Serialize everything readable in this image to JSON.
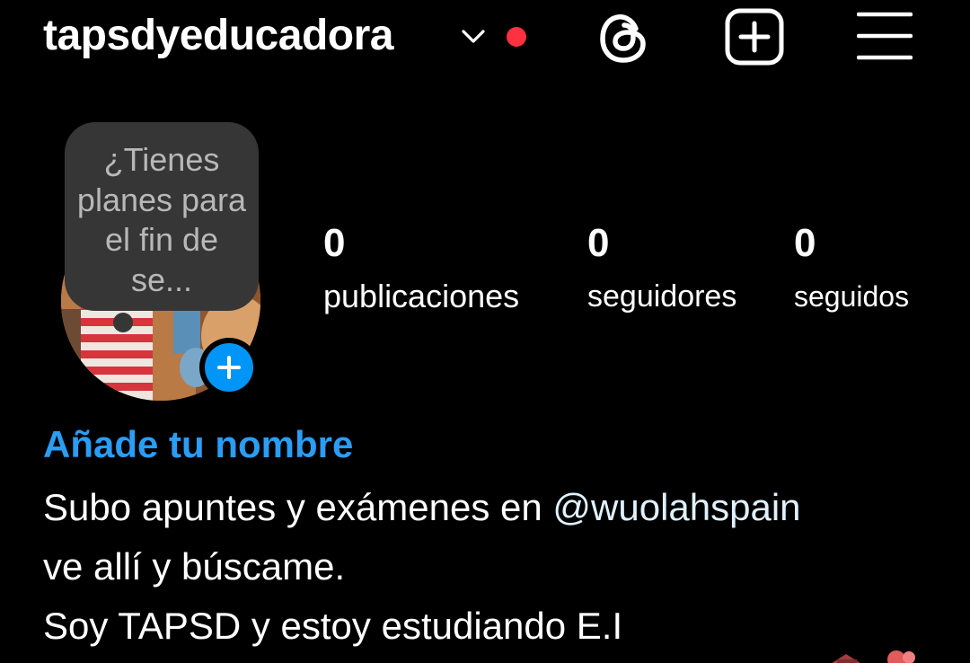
{
  "header": {
    "username": "tapsdyeducadora",
    "icons": [
      "chevron-down-icon",
      "threads-icon",
      "create-post-icon",
      "menu-icon"
    ],
    "notification_color": "#ff3040"
  },
  "profile": {
    "note_text": "¿Tienes planes para el fin de se...",
    "add_story_icon": "plus-icon",
    "accent_color": "#0095f6"
  },
  "stats": {
    "posts_count": "0",
    "posts_label": "publicaciones",
    "followers_count": "0",
    "followers_label": "seguidores",
    "following_count": "0",
    "following_label": "seguidos"
  },
  "bio": {
    "add_name_label": "Añade tu nombre",
    "line1_text": "Subo apuntes y exámenes en ",
    "line1_mention": "@wuolahspain",
    "line2": "ve allí y búscame.",
    "line3": "Soy TAPSD y estoy estudiando E.I"
  }
}
